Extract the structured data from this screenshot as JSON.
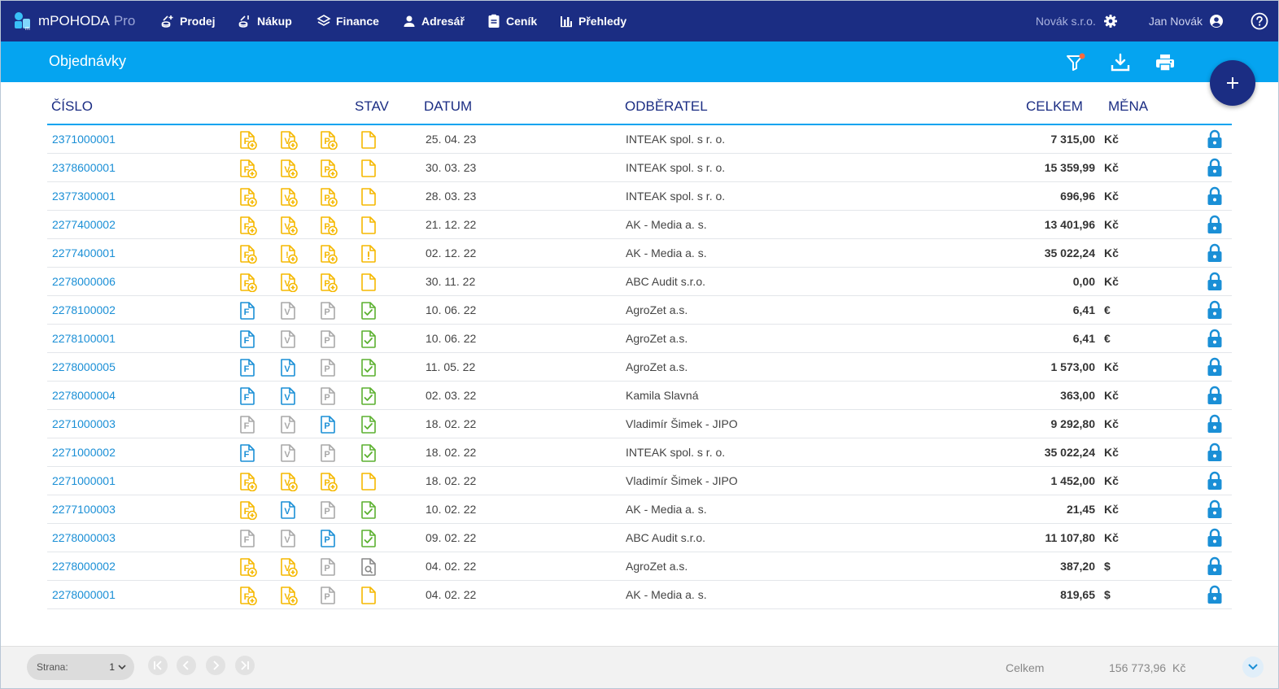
{
  "app": {
    "name": "mPOHODA",
    "edition": "Pro"
  },
  "nav": [
    {
      "label": "Prodej",
      "icon": "coins-up-icon"
    },
    {
      "label": "Nákup",
      "icon": "coins-down-icon"
    },
    {
      "label": "Finance",
      "icon": "layers-icon"
    },
    {
      "label": "Adresář",
      "icon": "person-icon"
    },
    {
      "label": "Ceník",
      "icon": "price-list-icon"
    },
    {
      "label": "Přehledy",
      "icon": "bar-chart-icon"
    }
  ],
  "company": "Novák s.r.o.",
  "user": "Jan Novák",
  "page_title": "Objednávky",
  "columns": {
    "number": "ČÍSLO",
    "status": "STAV",
    "date": "DATUM",
    "customer": "ODBĚRATEL",
    "total": "CELKEM",
    "currency": "MĚNA"
  },
  "colors": {
    "navy": "#1b2d83",
    "blue": "#05a4f0",
    "link": "#1a8fd6",
    "yellow": "#f5b800",
    "green": "#5cb130",
    "gray": "#a8a8a8",
    "lock": "#1a8fd6"
  },
  "rows": [
    {
      "number": "2371000001",
      "docs": [
        "add-yellow",
        "add-yellow",
        "add-yellow"
      ],
      "state": "doc-yellow",
      "date": "25. 04. 23",
      "customer": "INTEAK spol. s r. o.",
      "total": "7 315,00",
      "currency": "Kč"
    },
    {
      "number": "2378600001",
      "docs": [
        "add-yellow",
        "add-yellow",
        "add-yellow"
      ],
      "state": "doc-yellow",
      "date": "30. 03. 23",
      "customer": "INTEAK spol. s r. o.",
      "total": "15 359,99",
      "currency": "Kč"
    },
    {
      "number": "2377300001",
      "docs": [
        "add-yellow",
        "add-yellow",
        "add-yellow"
      ],
      "state": "doc-yellow",
      "date": "28. 03. 23",
      "customer": "INTEAK spol. s r. o.",
      "total": "696,96",
      "currency": "Kč"
    },
    {
      "number": "2277400002",
      "docs": [
        "add-yellow",
        "add-yellow",
        "add-yellow"
      ],
      "state": "doc-yellow",
      "date": "21. 12. 22",
      "customer": "AK - Media a. s.",
      "total": "13 401,96",
      "currency": "Kč"
    },
    {
      "number": "2277400001",
      "docs": [
        "add-yellow",
        "warn-yellow",
        "add-yellow"
      ],
      "state": "warn-yellow",
      "date": "02. 12. 22",
      "customer": "AK - Media a. s.",
      "total": "35 022,24",
      "currency": "Kč"
    },
    {
      "number": "2278000006",
      "docs": [
        "add-yellow",
        "add-yellow",
        "add-yellow"
      ],
      "state": "doc-yellow",
      "date": "30. 11. 22",
      "customer": "ABC Audit s.r.o.",
      "total": "0,00",
      "currency": "Kč"
    },
    {
      "number": "2278100002",
      "docs": [
        "blue",
        "gray",
        "gray"
      ],
      "state": "check-green",
      "date": "10. 06. 22",
      "customer": "AgroZet a.s.",
      "total": "6,41",
      "currency": "€"
    },
    {
      "number": "2278100001",
      "docs": [
        "blue",
        "gray",
        "gray"
      ],
      "state": "check-green",
      "date": "10. 06. 22",
      "customer": "AgroZet a.s.",
      "total": "6,41",
      "currency": "€"
    },
    {
      "number": "2278000005",
      "docs": [
        "blue",
        "blue",
        "gray"
      ],
      "state": "check-green",
      "date": "11. 05. 22",
      "customer": "AgroZet a.s.",
      "total": "1 573,00",
      "currency": "Kč"
    },
    {
      "number": "2278000004",
      "docs": [
        "blue",
        "blue",
        "gray"
      ],
      "state": "check-green",
      "date": "02. 03. 22",
      "customer": "Kamila Slavná",
      "total": "363,00",
      "currency": "Kč"
    },
    {
      "number": "2271000003",
      "docs": [
        "gray",
        "gray",
        "blue"
      ],
      "state": "check-green",
      "date": "18. 02. 22",
      "customer": "Vladimír Šimek - JIPO",
      "total": "9 292,80",
      "currency": "Kč"
    },
    {
      "number": "2271000002",
      "docs": [
        "blue",
        "gray",
        "gray"
      ],
      "state": "check-green",
      "date": "18. 02. 22",
      "customer": "INTEAK spol. s r. o.",
      "total": "35 022,24",
      "currency": "Kč"
    },
    {
      "number": "2271000001",
      "docs": [
        "add-yellow",
        "add-yellow",
        "add-yellow"
      ],
      "state": "doc-yellow",
      "date": "18. 02. 22",
      "customer": "Vladimír Šimek - JIPO",
      "total": "1 452,00",
      "currency": "Kč"
    },
    {
      "number": "2277100003",
      "docs": [
        "add-yellow",
        "blue",
        "gray"
      ],
      "state": "check-green",
      "date": "10. 02. 22",
      "customer": "AK - Media a. s.",
      "total": "21,45",
      "currency": "Kč"
    },
    {
      "number": "2278000003",
      "docs": [
        "gray",
        "gray",
        "blue"
      ],
      "state": "check-green",
      "date": "09. 02. 22",
      "customer": "ABC Audit s.r.o.",
      "total": "11 107,80",
      "currency": "Kč"
    },
    {
      "number": "2278000002",
      "docs": [
        "add-yellow",
        "add-yellow",
        "gray"
      ],
      "state": "search-gray",
      "date": "04. 02. 22",
      "customer": "AgroZet a.s.",
      "total": "387,20",
      "currency": "$"
    },
    {
      "number": "2278000001",
      "docs": [
        "add-yellow",
        "add-yellow",
        "gray"
      ],
      "state": "doc-yellow",
      "date": "04. 02. 22",
      "customer": "AK - Media a. s.",
      "total": "819,65",
      "currency": "$"
    }
  ],
  "doc_letters": [
    "F",
    "V",
    "P"
  ],
  "footer": {
    "page_label": "Strana:",
    "page_value": "1",
    "total_label": "Celkem",
    "total_value": "156 773,96",
    "total_currency": "Kč"
  }
}
